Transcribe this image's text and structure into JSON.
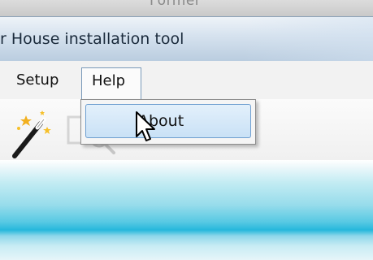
{
  "background_window": {
    "title_fragment": "Former"
  },
  "window": {
    "title": "r House installation tool"
  },
  "menu": {
    "items": [
      {
        "label": "Setup"
      },
      {
        "label": "Help"
      }
    ]
  },
  "help_menu": {
    "items": [
      {
        "label": "About"
      }
    ]
  },
  "toolbar": {
    "tools": [
      "magic-wand-icon",
      "faded-search-tool-icon"
    ]
  },
  "colors": {
    "accent_cyan": "#26b7dc",
    "menu_highlight_border": "#6f9fd0",
    "title_bar": "#c6d6e6"
  }
}
